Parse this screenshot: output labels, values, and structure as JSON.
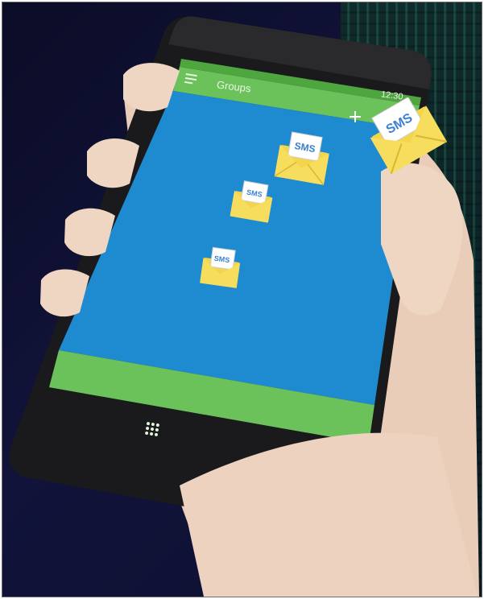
{
  "app_bar": {
    "title": "Groups",
    "time": "12:30",
    "menu_icon": "menu-icon",
    "add_icon": "plus-icon"
  },
  "envelopes": [
    {
      "label": "SMS"
    },
    {
      "label": "SMS"
    },
    {
      "label": "SMS"
    },
    {
      "label": "SMS"
    }
  ],
  "bottom_bar": {
    "icon": "grid-dots-icon"
  },
  "colors": {
    "screen_blue": "#1e8bd0",
    "app_bar_green": "#6cc25a",
    "envelope_yellow": "#f2d54a",
    "background": "#0e1034"
  }
}
